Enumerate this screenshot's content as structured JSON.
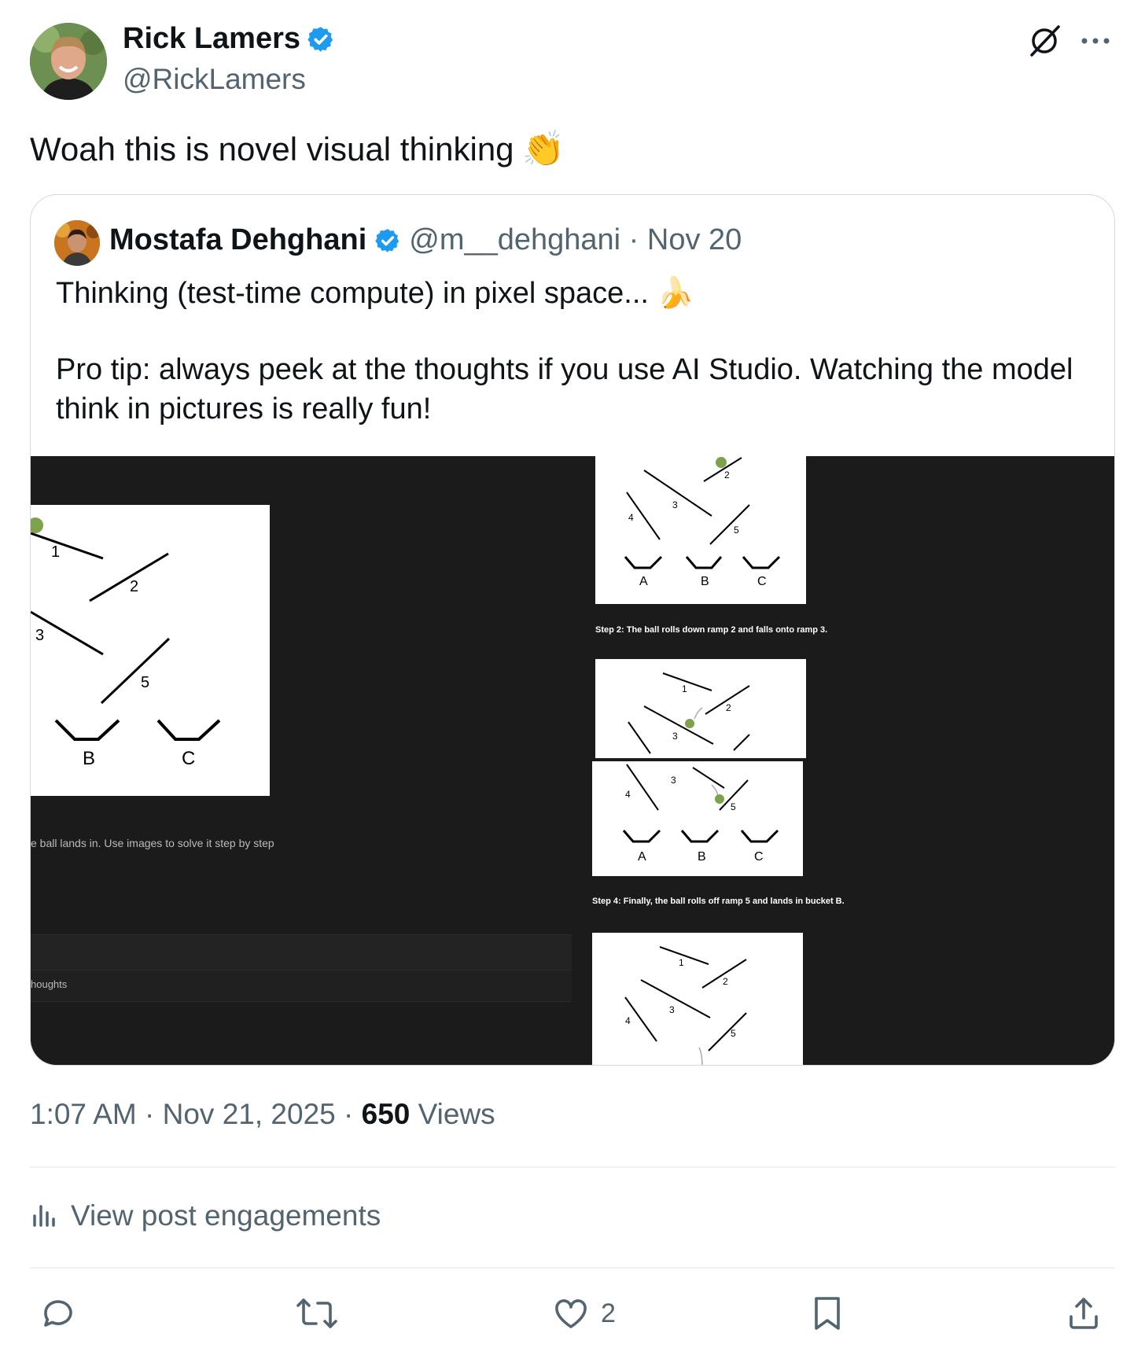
{
  "post": {
    "author_name": "Rick Lamers",
    "handle": "@RickLamers",
    "text": "Woah this is novel visual thinking",
    "emoji": "👏",
    "timestamp": "1:07 AM · Nov 21, 2025 · ",
    "views_count": "650",
    "views_label": "Views",
    "engagements_label": "View post engagements",
    "likes_count": "2"
  },
  "quoted": {
    "author_name": "Mostafa Dehghani",
    "handle_date": "@m__dehghani · Nov 20",
    "line1": "Thinking (test-time compute) in pixel space...",
    "emoji": "🍌",
    "line2": "Pro tip: always peek at the thoughts if you use AI Studio. Watching the model think in pictures is really fun!"
  },
  "media": {
    "left_caption": "e ball lands in. Use images to solve it step by step",
    "left_footer": "houghts",
    "step2_caption": "Step 2: The ball rolls down ramp 2 and falls onto ramp 3.",
    "step4_caption": "Step 4: Finally, the ball rolls off ramp 5 and lands in bucket B.",
    "labels": {
      "r1": "1",
      "r2": "2",
      "r3": "3",
      "r4": "4",
      "r5": "5",
      "a": "A",
      "b": "B",
      "c": "C"
    }
  },
  "colors": {
    "verified": "#1d9bf0",
    "ball": "#7da24b",
    "muted": "#536471"
  }
}
